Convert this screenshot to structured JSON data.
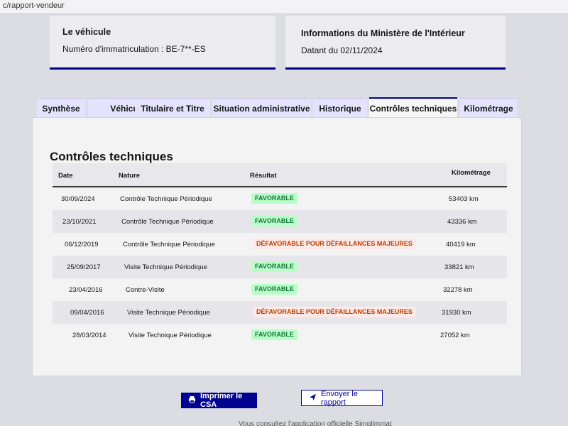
{
  "browser": {
    "url_fragment": "c/rapport-vendeur"
  },
  "vehicle_card": {
    "title": "Le véhicule",
    "registration_text": "Numéro d'immatriculation : BE-7**-ES"
  },
  "ministry_card": {
    "title": "Informations du Ministère de l'Intérieur",
    "date_text": "Datant du 02/11/2024"
  },
  "tabs": [
    {
      "label": "Synthèse",
      "active": false
    },
    {
      "label": "Véhicule",
      "active": false
    },
    {
      "label": "Titulaire et Titre",
      "active": false
    },
    {
      "label": "Situation administrative",
      "active": false
    },
    {
      "label": "Historique",
      "active": false
    },
    {
      "label": "Contrôles techniques",
      "active": true
    },
    {
      "label": "Kilométrage",
      "active": false
    }
  ],
  "section": {
    "title": "Contrôles techniques",
    "columns": [
      "Date",
      "Nature",
      "Résultat",
      "Kilométrage"
    ],
    "rows": [
      {
        "date": "30/09/2024",
        "nature": "Contrôle Technique Périodique",
        "result": "FAVORABLE",
        "status": "ok",
        "km": "53403 km"
      },
      {
        "date": "23/10/2021",
        "nature": "Contrôle Technique Périodique",
        "result": "FAVORABLE",
        "status": "ok",
        "km": "43336 km"
      },
      {
        "date": "06/12/2019",
        "nature": "Contrôle Technique Périodique",
        "result": "DÉFAVORABLE POUR DÉFAILLANCES MAJEURES",
        "status": "ko",
        "km": "40419 km"
      },
      {
        "date": "25/09/2017",
        "nature": "Visite Technique Périodique",
        "result": "FAVORABLE",
        "status": "ok",
        "km": "33821 km"
      },
      {
        "date": "23/04/2016",
        "nature": "Contre-Visite",
        "result": "FAVORABLE",
        "status": "ok",
        "km": "32278 km"
      },
      {
        "date": "09/04/2016",
        "nature": "Visite Technique Périodique",
        "result": "DÉFAVORABLE POUR DÉFAILLANCES MAJEURES",
        "status": "ko",
        "km": "31930 km"
      },
      {
        "date": "28/03/2014",
        "nature": "Visite Technique Périodique",
        "result": "FAVORABLE",
        "status": "ok",
        "km": "27052 km"
      }
    ]
  },
  "actions": {
    "print_label": "Imprimer le CSA",
    "send_label": "Envoyer le rapport"
  },
  "footer": {
    "text": "Vous consultez l'application officielle Simplimmat"
  },
  "colors": {
    "primary": "#000091",
    "success_bg": "#b8fec9",
    "success_text": "#18753c",
    "error_bg": "#ffe9e6",
    "error_text": "#b34000"
  },
  "icons": {
    "print": "printer-icon",
    "send": "send-icon"
  }
}
